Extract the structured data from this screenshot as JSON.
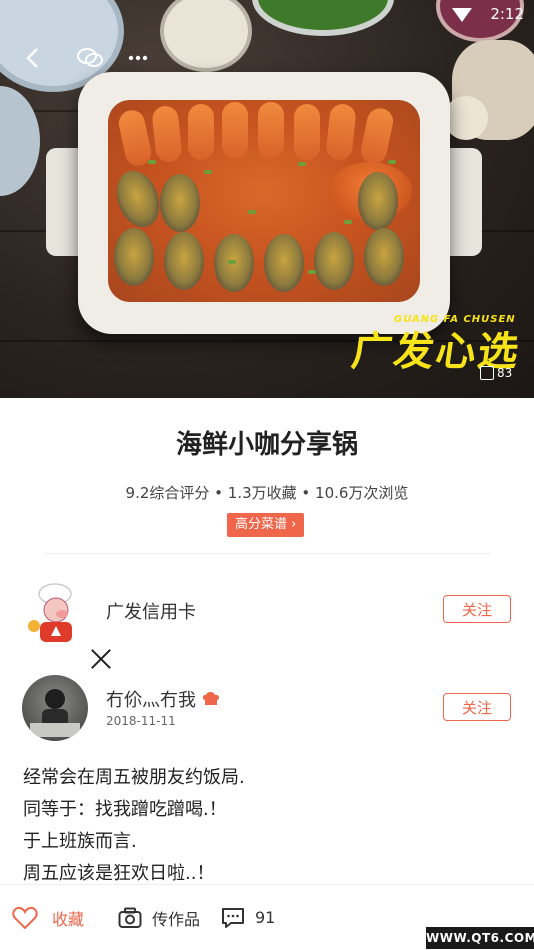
{
  "status": {
    "time": "2:12"
  },
  "hero": {
    "brand_text": "广发心选",
    "brand_small": "GUANG FA CHUSEN",
    "image_count": "83"
  },
  "recipe": {
    "title": "海鲜小咖分享锅",
    "stats": "9.2综合评分 • 1.3万收藏 • 10.6万次浏览",
    "tag": "高分菜谱 ›"
  },
  "authors": [
    {
      "name": "广发信用卡",
      "follow_label": "关注"
    },
    {
      "name": "冇伱灬冇我",
      "date": "2018-11-11",
      "follow_label": "关注"
    }
  ],
  "description": [
    "经常会在周五被朋友约饭局.",
    "同等于：找我蹭吃蹭喝.！",
    "于上班族而言.",
    "周五应该是狂欢日啦..！"
  ],
  "bottom_bar": {
    "favorite_label": "收藏",
    "upload_label": "传作品",
    "comment_count": "91"
  },
  "watermark": "WWW.QT6.COM",
  "colors": {
    "accent": "#f0664b",
    "brand_yellow": "#f7e318"
  },
  "icons": [
    "back-icon",
    "wechat-icon",
    "more-icon",
    "gallery-icon",
    "chef-hat-icon",
    "heart-icon",
    "camera-icon",
    "comment-icon"
  ]
}
